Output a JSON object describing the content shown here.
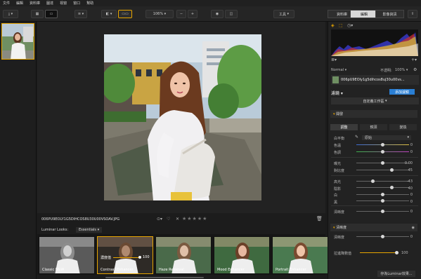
{
  "menu": [
    "文件",
    "編輯",
    "資料庫",
    "圖達",
    "視窗",
    "窗口",
    "幫助"
  ],
  "toolbar": {
    "zoom": "106%",
    "minus": "−",
    "plus": "+",
    "tools": "工具",
    "tabs": [
      "資料庫",
      "編輯",
      "影像資訊"
    ]
  },
  "image": {
    "filename": "006PU9EOLY1G5DIHCOS8U30U00VSOAV.JPG",
    "rating_hint": "★★★★★"
  },
  "looks": {
    "label": "Luminar Looks:",
    "category": "Essentials",
    "items": [
      "Classic B&W",
      "Contrast Enhancer",
      "Haze Removal",
      "Mood Enhancer",
      "Portrait Enhancer"
    ],
    "amount_label": "濃度值",
    "amount_value": "100"
  },
  "panel": {
    "blend": "Normal",
    "opacity_label": "不透明:",
    "opacity_value": "100%",
    "layer_name": "006pU9EOly1g5dihcos8uj30u00vs...",
    "filters_label": "濾鏡",
    "add_filter": "添加濾鏡",
    "workspace": "自定義工作區",
    "section_develop": "開發",
    "subtabs": [
      "調整",
      "鏡頭",
      "變換"
    ],
    "wb_label": "白平衡",
    "wb_value": "原始",
    "sliders1": [
      {
        "label": "色溫",
        "value": "0",
        "pos": 0.5
      },
      {
        "label": "色調",
        "value": "0",
        "pos": 0.5
      }
    ],
    "sliders2": [
      {
        "label": "曝光",
        "value": "0.00",
        "pos": 0.5
      },
      {
        "label": "對比度",
        "value": "45",
        "pos": 0.68
      }
    ],
    "sliders3": [
      {
        "label": "高光",
        "value": "-43",
        "pos": 0.3
      },
      {
        "label": "陰影",
        "value": "40",
        "pos": 0.68
      },
      {
        "label": "白",
        "value": "0",
        "pos": 0.5
      },
      {
        "label": "黑",
        "value": "0",
        "pos": 0.5
      }
    ],
    "sliders4": [
      {
        "label": "清晰度",
        "value": "0",
        "pos": 0.5
      }
    ],
    "section_clarity": "清晰度",
    "clarity_label": "清晰度",
    "clarity_value": "0",
    "fade_label": "拉進降數值",
    "fade_value": "100",
    "save_btn": "存為Luminar效果..."
  },
  "colors": {
    "accent": "#e7a500",
    "blue": "#2a7fd4"
  }
}
